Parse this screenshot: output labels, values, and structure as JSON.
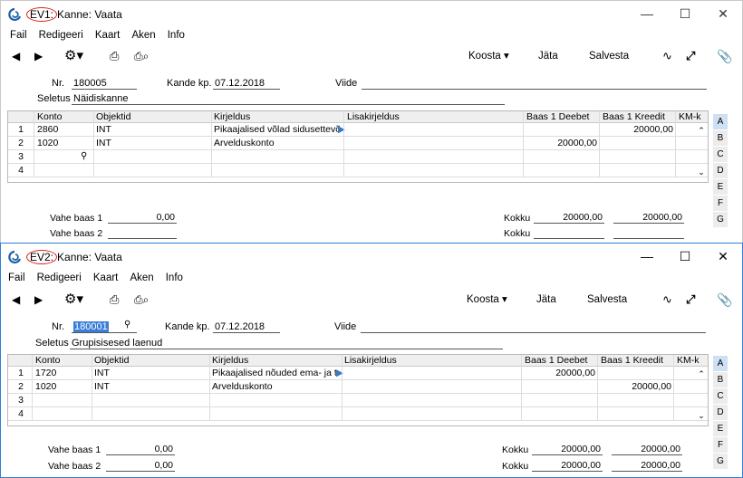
{
  "w1": {
    "tag": "EV1:",
    "title": "Kanne: Vaata",
    "menu": [
      "Fail",
      "Redigeeri",
      "Kaart",
      "Aken",
      "Info"
    ],
    "toolbar": {
      "koosta": "Koosta ▾",
      "jata": "Jäta",
      "salvesta": "Salvesta"
    },
    "nr_label": "Nr.",
    "nr": "180005",
    "date_label": "Kande kp.",
    "date": "07.12.2018",
    "viide_label": "Viide",
    "seletus_label": "Seletus",
    "seletus": "Näidiskanne",
    "cols": [
      "Konto",
      "Objektid",
      "Kirjeldus",
      "Lisakirjeldus",
      "Baas 1 Deebet",
      "Baas 1 Kreedit",
      "KM-k"
    ],
    "rows": [
      {
        "n": "1",
        "konto": "2860",
        "obj": "INT",
        "kirj": "Pikaajalised võlad sidusettevõt",
        "deebet": "",
        "kreedit": "20000,00"
      },
      {
        "n": "2",
        "konto": "1020",
        "obj": "INT",
        "kirj": "Arvelduskonto",
        "deebet": "20000,00",
        "kreedit": ""
      },
      {
        "n": "3",
        "konto": "",
        "obj": "",
        "kirj": "",
        "deebet": "",
        "kreedit": ""
      },
      {
        "n": "4",
        "konto": "",
        "obj": "",
        "kirj": "",
        "deebet": "",
        "kreedit": ""
      }
    ],
    "vahe1_label": "Vahe baas 1",
    "vahe1": "0,00",
    "vahe2_label": "Vahe baas 2",
    "vahe2": "",
    "kokku1_label": "Kokku",
    "kokku1_d": "20000,00",
    "kokku1_k": "20000,00",
    "kokku2_label": "Kokku",
    "kokku2_d": "",
    "kokku2_k": "",
    "tabs": [
      "A",
      "B",
      "C",
      "D",
      "E",
      "F",
      "G"
    ]
  },
  "w2": {
    "tag": "EV2:",
    "title": "Kanne: Vaata",
    "menu": [
      "Fail",
      "Redigeeri",
      "Kaart",
      "Aken",
      "Info"
    ],
    "toolbar": {
      "koosta": "Koosta ▾",
      "jata": "Jäta",
      "salvesta": "Salvesta"
    },
    "nr_label": "Nr.",
    "nr": "180001",
    "date_label": "Kande kp.",
    "date": "07.12.2018",
    "viide_label": "Viide",
    "seletus_label": "Seletus",
    "seletus": "Grupisisesed laenud",
    "cols": [
      "Konto",
      "Objektid",
      "Kirjeldus",
      "Lisakirjeldus",
      "Baas 1 Deebet",
      "Baas 1 Kreedit",
      "KM-k"
    ],
    "rows": [
      {
        "n": "1",
        "konto": "1720",
        "obj": "INT",
        "kirj": "Pikaajalised nõuded ema- ja te",
        "deebet": "20000,00",
        "kreedit": ""
      },
      {
        "n": "2",
        "konto": "1020",
        "obj": "INT",
        "kirj": "Arvelduskonto",
        "deebet": "",
        "kreedit": "20000,00"
      },
      {
        "n": "3",
        "konto": "",
        "obj": "",
        "kirj": "",
        "deebet": "",
        "kreedit": ""
      },
      {
        "n": "4",
        "konto": "",
        "obj": "",
        "kirj": "",
        "deebet": "",
        "kreedit": ""
      }
    ],
    "vahe1_label": "Vahe baas 1",
    "vahe1": "0,00",
    "vahe2_label": "Vahe baas 2",
    "vahe2": "0,00",
    "kokku1_label": "Kokku",
    "kokku1_d": "20000,00",
    "kokku1_k": "20000,00",
    "kokku2_label": "Kokku",
    "kokku2_d": "20000,00",
    "kokku2_k": "20000,00",
    "tabs": [
      "A",
      "B",
      "C",
      "D",
      "E",
      "F",
      "G"
    ]
  },
  "colors": {
    "active_border": "#2f7fd6",
    "tag_circle": "#dd2222",
    "selection": "#3b7ed8",
    "tab_active": "#cde0f4"
  },
  "icons": [
    "app-logo-icon",
    "back-icon",
    "forward-icon",
    "gear-icon",
    "print-icon",
    "print-preview-icon",
    "minimize-icon",
    "maximize-icon",
    "close-icon",
    "flip-icon",
    "expand-icon",
    "attach-icon",
    "search-icon"
  ]
}
